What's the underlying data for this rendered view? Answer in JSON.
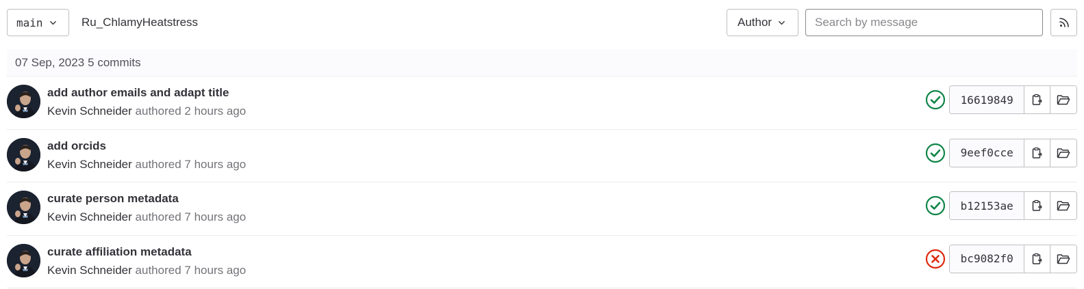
{
  "toolbar": {
    "branch": "main",
    "project": "Ru_ChlamyHeatstress",
    "author_label": "Author",
    "search_placeholder": "Search by message"
  },
  "day_group": {
    "date": "07 Sep, 2023",
    "count": "5 commits"
  },
  "commits": [
    {
      "title": "add author emails and adapt title",
      "author": "Kevin Schneider",
      "verb": "authored",
      "time": "2 hours ago",
      "sha": "16619849",
      "status": "success"
    },
    {
      "title": "add orcids",
      "author": "Kevin Schneider",
      "verb": "authored",
      "time": "7 hours ago",
      "sha": "9eef0cce",
      "status": "success"
    },
    {
      "title": "curate person metadata",
      "author": "Kevin Schneider",
      "verb": "authored",
      "time": "7 hours ago",
      "sha": "b12153ae",
      "status": "success"
    },
    {
      "title": "curate affiliation metadata",
      "author": "Kevin Schneider",
      "verb": "authored",
      "time": "7 hours ago",
      "sha": "bc9082f0",
      "status": "failed"
    }
  ],
  "colors": {
    "success": "#108548",
    "failed": "#dd2b0e"
  },
  "icons": {
    "branch_dropdown": "chevron-down-icon",
    "author_dropdown": "chevron-down-icon",
    "feed": "rss-icon",
    "copy": "copy-to-clipboard-icon",
    "browse": "folder-open-icon",
    "success": "status-success-icon",
    "failed": "status-failed-icon"
  }
}
